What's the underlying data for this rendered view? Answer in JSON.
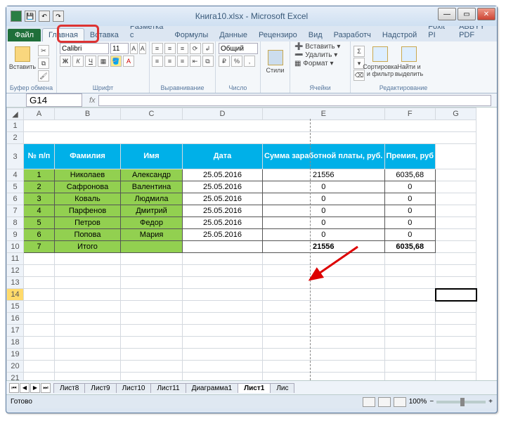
{
  "window": {
    "title": "Книга10.xlsx - Microsoft Excel"
  },
  "tabs": {
    "file": "Файл",
    "home": "Главная",
    "insert": "Вставка",
    "layout": "Разметка с",
    "formulas": "Формулы",
    "data": "Данные",
    "review": "Рецензиро",
    "view": "Вид",
    "developer": "Разработч",
    "addins": "Надстрой",
    "foxit": "Foxit PI",
    "abbyy": "ABBYY PDF"
  },
  "ribbon": {
    "clipboard": {
      "paste": "Вставить",
      "label": "Буфер обмена"
    },
    "font": {
      "name": "Calibri",
      "size": "11",
      "label": "Шрифт"
    },
    "align": {
      "label": "Выравнивание"
    },
    "number": {
      "format": "Общий",
      "label": "Число"
    },
    "styles": {
      "btn": "Стили",
      "label": ""
    },
    "cells": {
      "insert": "Вставить",
      "delete": "Удалить",
      "format": "Формат",
      "label": "Ячейки"
    },
    "editing": {
      "sort": "Сортировка\nи фильтр",
      "find": "Найти и\nвыделить",
      "label": "Редактирование"
    }
  },
  "namebox": "G14",
  "formula": "",
  "columns": [
    "A",
    "B",
    "C",
    "D",
    "E",
    "F",
    "G"
  ],
  "header": {
    "a": "№ п/п",
    "b": "Фамилия",
    "c": "Имя",
    "d": "Дата",
    "e": "Сумма заработной платы, руб.",
    "f": "Премия, руб"
  },
  "data": [
    {
      "n": "1",
      "fam": "Николаев",
      "name": "Александр",
      "date": "25.05.2016",
      "sum": "21556",
      "prem": "6035,68"
    },
    {
      "n": "2",
      "fam": "Сафронова",
      "name": "Валентина",
      "date": "25.05.2016",
      "sum": "0",
      "prem": "0"
    },
    {
      "n": "3",
      "fam": "Коваль",
      "name": "Людмила",
      "date": "25.05.2016",
      "sum": "0",
      "prem": "0"
    },
    {
      "n": "4",
      "fam": "Парфенов",
      "name": "Дмитрий",
      "date": "25.05.2016",
      "sum": "0",
      "prem": "0"
    },
    {
      "n": "5",
      "fam": "Петров",
      "name": "Федор",
      "date": "25.05.2016",
      "sum": "0",
      "prem": "0"
    },
    {
      "n": "6",
      "fam": "Попова",
      "name": "Мария",
      "date": "25.05.2016",
      "sum": "0",
      "prem": "0"
    },
    {
      "n": "7",
      "fam": "Итого",
      "name": "",
      "date": "",
      "sum": "21556",
      "prem": "6035,68"
    }
  ],
  "sheets": [
    "Лист8",
    "Лист9",
    "Лист10",
    "Лист11",
    "Диаграмма1",
    "Лист1",
    "Лис"
  ],
  "active_sheet": "Лист1",
  "status": "Готово",
  "zoom": "100%"
}
